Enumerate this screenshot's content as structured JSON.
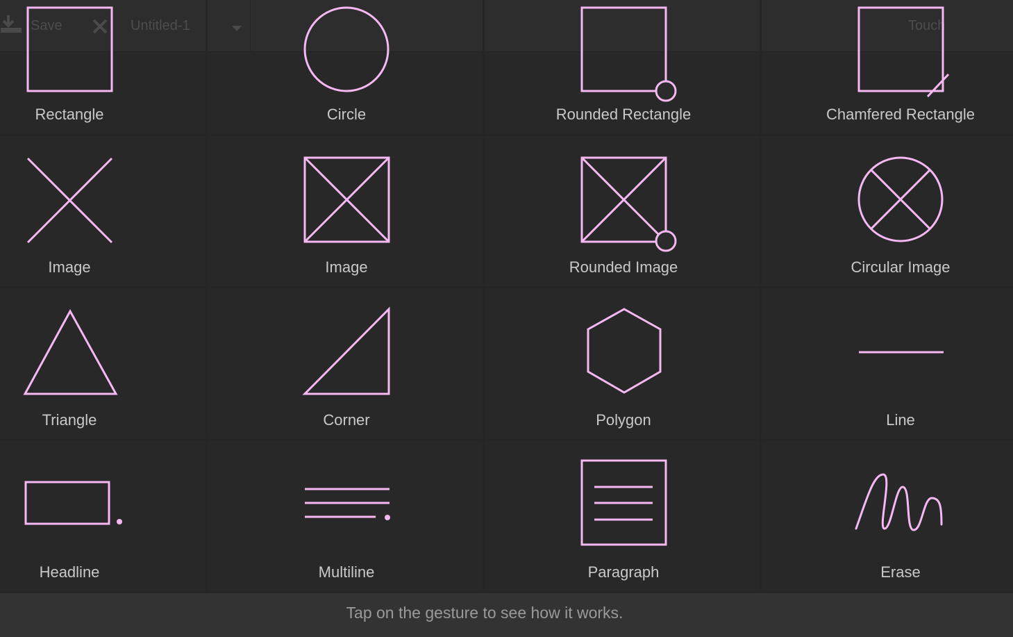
{
  "toolbar": {
    "save_label": "Save",
    "document_title": "Untitled-1",
    "touch_label": "Touch"
  },
  "colors": {
    "gesture_stroke": "#f5b8f2",
    "background": "#2b2b2b",
    "label_text": "#c9c9c9"
  },
  "gestures": [
    {
      "label": "Rectangle",
      "icon": "rectangle-gesture-icon"
    },
    {
      "label": "Circle",
      "icon": "circle-gesture-icon"
    },
    {
      "label": "Rounded Rectangle",
      "icon": "rounded-rectangle-gesture-icon"
    },
    {
      "label": "Chamfered Rectangle",
      "icon": "chamfered-rectangle-gesture-icon"
    },
    {
      "label": "Image",
      "icon": "x-image-gesture-icon"
    },
    {
      "label": "Image",
      "icon": "boxed-x-image-gesture-icon"
    },
    {
      "label": "Rounded Image",
      "icon": "rounded-image-gesture-icon"
    },
    {
      "label": "Circular Image",
      "icon": "circular-image-gesture-icon"
    },
    {
      "label": "Triangle",
      "icon": "triangle-gesture-icon"
    },
    {
      "label": "Corner",
      "icon": "corner-gesture-icon"
    },
    {
      "label": "Polygon",
      "icon": "polygon-gesture-icon"
    },
    {
      "label": "Line",
      "icon": "line-gesture-icon"
    },
    {
      "label": "Headline",
      "icon": "headline-gesture-icon"
    },
    {
      "label": "Multiline",
      "icon": "multiline-gesture-icon"
    },
    {
      "label": "Paragraph",
      "icon": "paragraph-gesture-icon"
    },
    {
      "label": "Erase",
      "icon": "erase-gesture-icon"
    }
  ],
  "footer": {
    "hint": "Tap on the gesture to see how it works."
  }
}
